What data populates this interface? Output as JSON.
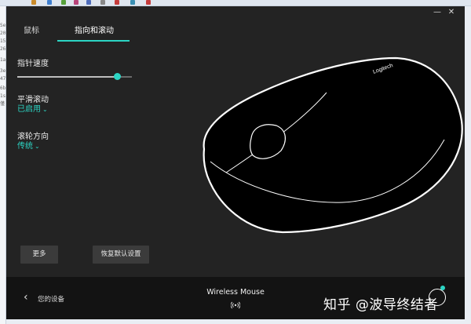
{
  "background_desktop": {
    "left_text_fragments": [
      "Se",
      "20",
      "15",
      "26",
      "1a",
      "3e",
      "47",
      "6b",
      "1s",
      "僅"
    ]
  },
  "window": {
    "controls": {
      "close": "✕",
      "minimize": "—"
    }
  },
  "tabs": [
    {
      "label": "鼠标",
      "active": false
    },
    {
      "label": "指向和滚动",
      "active": true
    }
  ],
  "pointer_speed": {
    "label": "指针速度",
    "value_fraction": 0.87
  },
  "smooth_scrolling": {
    "label": "平滑滚动",
    "value": "已启用"
  },
  "scroll_direction": {
    "label": "滚轮方向",
    "value": "传统"
  },
  "buttons": {
    "more": "更多",
    "restore_defaults": "恢复默认设置"
  },
  "footer": {
    "back_label": "您的设备",
    "device_name": "Wireless Mouse",
    "connection_icon": "wireless-signal-icon"
  },
  "mouse_brand_text": "Logitech",
  "watermark": "知乎 @波导终结者",
  "colors": {
    "accent": "#2cd5c4",
    "background": "#232323",
    "footer": "#131313"
  }
}
